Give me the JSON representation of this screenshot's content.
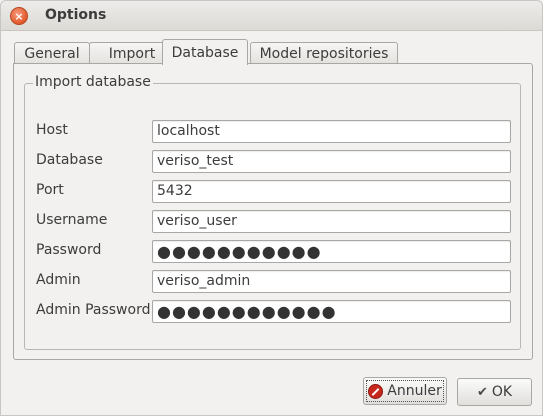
{
  "window": {
    "title": "Options",
    "close_glyph": "×"
  },
  "tabs": [
    {
      "label": "General"
    },
    {
      "label": "Import"
    },
    {
      "label": "Database",
      "active": true
    },
    {
      "label": "Model repositories"
    }
  ],
  "import_database": {
    "legend": "Import database",
    "fields": [
      {
        "label": "Host",
        "value": "localhost"
      },
      {
        "label": "Database",
        "value": "veriso_test"
      },
      {
        "label": "Port",
        "value": "5432"
      },
      {
        "label": "Username",
        "value": "veriso_user"
      },
      {
        "label": "Password",
        "value": "●●●●●●●●●●●"
      },
      {
        "label": "Admin",
        "value": "veriso_admin"
      },
      {
        "label": "Admin Password",
        "value": "●●●●●●●●●●●●"
      }
    ]
  },
  "buttons": {
    "cancel_label": "Annuler",
    "ok_label": "OK"
  },
  "icons": {
    "close": "close-icon",
    "cancel": "cancel-icon",
    "ok": "check-icon"
  },
  "colors": {
    "close_button": "#e25a2b",
    "cancel_icon": "#c8271c",
    "window_bg": "#f2f1f0"
  }
}
